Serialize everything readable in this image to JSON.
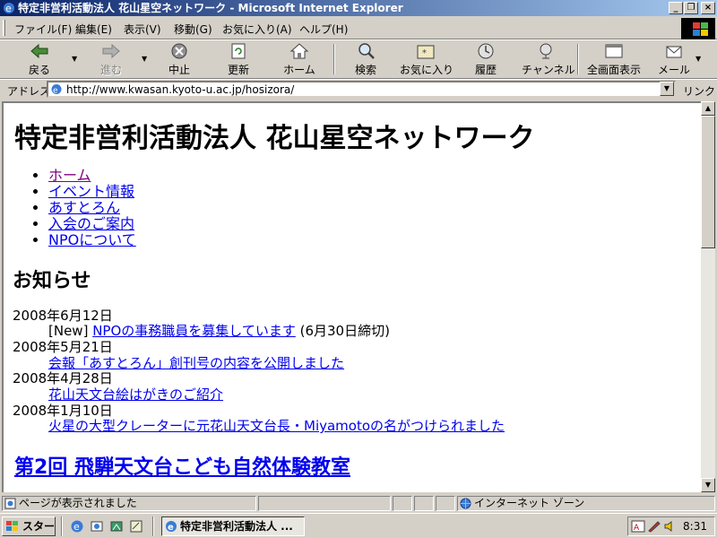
{
  "window": {
    "title": "特定非営利活動法人 花山星空ネットワーク - Microsoft Internet Explorer"
  },
  "menu": [
    "ファイル(F)",
    "編集(E)",
    "表示(V)",
    "移動(G)",
    "お気に入り(A)",
    "ヘルプ(H)"
  ],
  "toolbar": {
    "back": "戻る",
    "forward": "進む",
    "stop": "中止",
    "refresh": "更新",
    "home": "ホーム",
    "search": "検索",
    "favorites": "お気に入り",
    "history": "履歴",
    "channels": "チャンネル",
    "fullscreen": "全画面表示",
    "mail": "メール"
  },
  "address": {
    "label": "アドレス",
    "url": "http://www.kwasan.kyoto-u.ac.jp/hosizora/",
    "links": "リンク"
  },
  "page": {
    "heading": "特定非営利活動法人 花山星空ネットワーク",
    "nav": [
      "ホーム",
      "イベント情報",
      "あすとろん",
      "入会のご案内",
      "NPOについて"
    ],
    "news_heading": "お知らせ",
    "news": [
      {
        "date": "2008年6月12日",
        "prefix": "[New] ",
        "link": "NPOの事務職員を募集しています",
        "suffix": " (6月30日締切)"
      },
      {
        "date": "2008年5月21日",
        "prefix": "",
        "link": "会報「あすとろん」創刊号の内容を公開しました",
        "suffix": ""
      },
      {
        "date": "2008年4月28日",
        "prefix": "",
        "link": "花山天文台絵はがきのご紹介",
        "suffix": ""
      },
      {
        "date": "2008年1月10日",
        "prefix": "",
        "link": "火星の大型クレーターに元花山天文台長・Miyamotoの名がつけられました",
        "suffix": ""
      }
    ],
    "event_heading": "第2回 飛騨天文台こども自然体験教室"
  },
  "status": {
    "message": "ページが表示されました",
    "zone": "インターネット ゾーン"
  },
  "taskbar": {
    "start": "スタート",
    "task": "特定非営利活動法人 ...",
    "clock": "8:31"
  }
}
